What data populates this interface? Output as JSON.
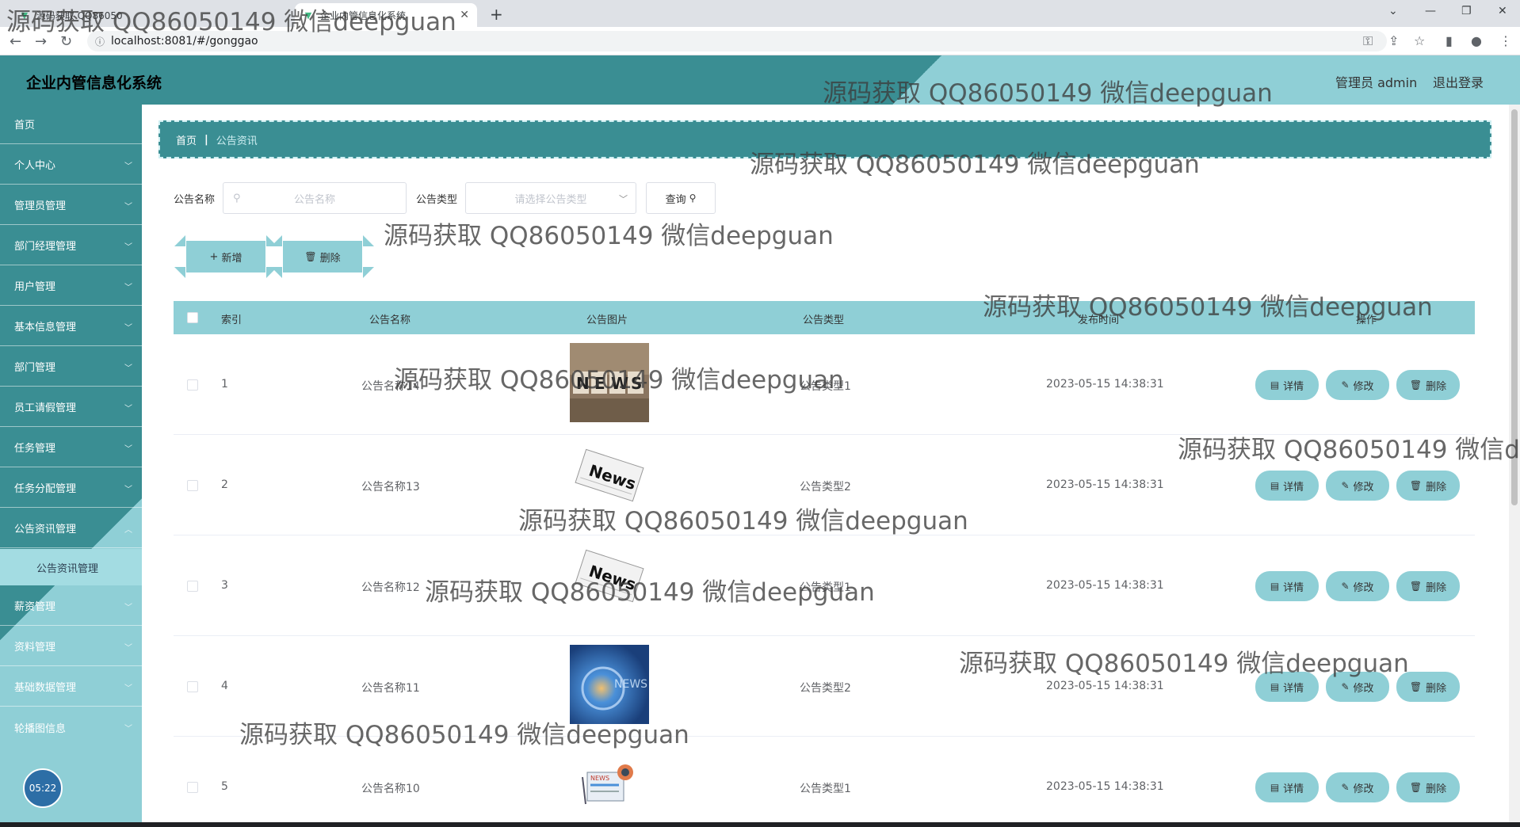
{
  "browser": {
    "tabs": [
      {
        "title": "源码获取 QQ86050149 微信deepguan"
      },
      {
        "title": "企业内管信息化系统"
      }
    ],
    "new_tab": "+",
    "url": "localhost:8081/#/gonggao"
  },
  "header": {
    "app_title": "企业内管信息化系统",
    "user_label": "管理员 admin",
    "logout_label": "退出登录"
  },
  "sidebar": {
    "items": [
      {
        "label": "首页"
      },
      {
        "label": "个人中心"
      },
      {
        "label": "管理员管理"
      },
      {
        "label": "部门经理管理"
      },
      {
        "label": "用户管理"
      },
      {
        "label": "基本信息管理"
      },
      {
        "label": "部门管理"
      },
      {
        "label": "员工请假管理"
      },
      {
        "label": "任务管理"
      },
      {
        "label": "任务分配管理"
      },
      {
        "label": "公告资讯管理"
      },
      {
        "label": "公告资讯管理"
      },
      {
        "label": "薪资管理"
      },
      {
        "label": "资料管理"
      },
      {
        "label": "基础数据管理"
      },
      {
        "label": "轮播图信息"
      }
    ],
    "clock": "05:22"
  },
  "breadcrumb": {
    "home": "首页",
    "current": "公告资讯"
  },
  "search": {
    "name_label": "公告名称",
    "name_placeholder": "公告名称",
    "type_label": "公告类型",
    "type_placeholder": "请选择公告类型",
    "query_button": "查询"
  },
  "actions": {
    "add_button": "新增",
    "delete_button": "删除"
  },
  "table": {
    "columns": [
      "索引",
      "公告名称",
      "公告图片",
      "公告类型",
      "发布时间",
      "操作"
    ],
    "rows": [
      {
        "index": "1",
        "name": "公告名称14",
        "type": "公告类型1",
        "time": "2023-05-15 14:38:31",
        "image": "news-blocks"
      },
      {
        "index": "2",
        "name": "公告名称13",
        "type": "公告类型2",
        "time": "2023-05-15 14:38:31",
        "image": "news-paper"
      },
      {
        "index": "3",
        "name": "公告名称12",
        "type": "公告类型1",
        "time": "2023-05-15 14:38:31",
        "image": "news-paper"
      },
      {
        "index": "4",
        "name": "公告名称11",
        "type": "公告类型2",
        "time": "2023-05-15 14:38:31",
        "image": "news-globe"
      },
      {
        "index": "5",
        "name": "公告名称10",
        "type": "公告类型1",
        "time": "2023-05-15 14:38:31",
        "image": "news-illustration"
      }
    ],
    "row_actions": {
      "detail": "详情",
      "edit": "修改",
      "delete": "删除"
    }
  },
  "watermark": "源码获取 QQ86050149 微信deepguan",
  "colors": {
    "teal_dark": "#3a8e93",
    "teal_light": "#8fcfd6"
  }
}
